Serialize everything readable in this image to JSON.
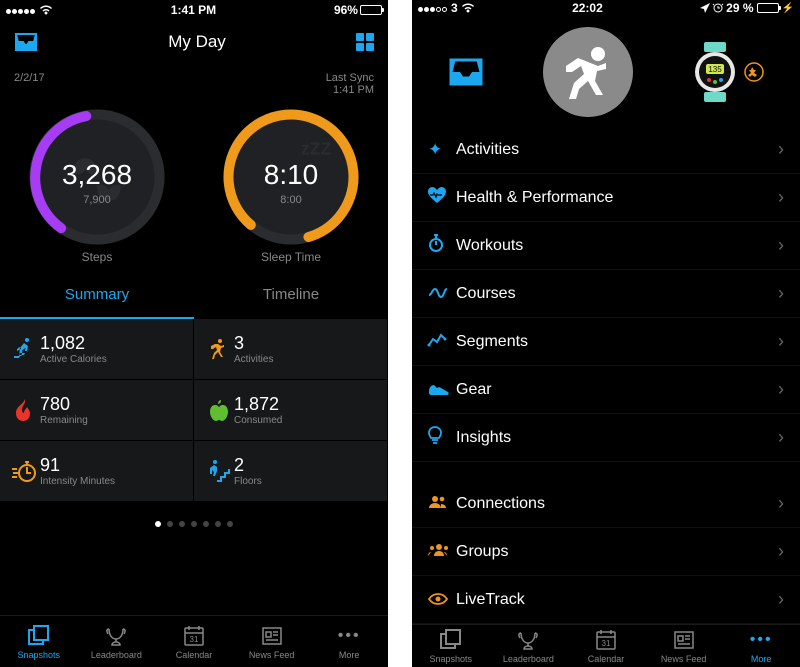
{
  "left": {
    "status": {
      "time": "1:41 PM",
      "battery_pct": "96%"
    },
    "nav": {
      "title": "My Day"
    },
    "meta": {
      "date": "2/2/17",
      "last_sync_label": "Last Sync",
      "last_sync_time": "1:41 PM"
    },
    "dials": {
      "steps": {
        "value": "3,268",
        "goal": "7,900",
        "label": "Steps"
      },
      "sleep": {
        "value": "8:10",
        "goal": "8:00",
        "label": "Sleep Time"
      }
    },
    "tabs": {
      "summary": "Summary",
      "timeline": "Timeline"
    },
    "grid": [
      {
        "value": "1,082",
        "label": "Active Calories",
        "icon": "run"
      },
      {
        "value": "3",
        "label": "Activities",
        "icon": "run2"
      },
      {
        "value": "780",
        "label": "Remaining",
        "icon": "flame"
      },
      {
        "value": "1,872",
        "label": "Consumed",
        "icon": "apple"
      },
      {
        "value": "91",
        "label": "Intensity Minutes",
        "icon": "stopwatch"
      },
      {
        "value": "2",
        "label": "Floors",
        "icon": "stairs"
      }
    ],
    "tabbar": {
      "snapshots": "Snapshots",
      "leaderboard": "Leaderboard",
      "calendar": "Calendar",
      "newsfeed": "News Feed",
      "more": "More"
    }
  },
  "right": {
    "status": {
      "carrier": "3",
      "time": "22:02",
      "battery_pct": "29 %"
    },
    "watch_value": "135",
    "menu1": [
      {
        "label": "Activities"
      },
      {
        "label": "Health & Performance"
      },
      {
        "label": "Workouts"
      },
      {
        "label": "Courses"
      },
      {
        "label": "Segments"
      },
      {
        "label": "Gear"
      },
      {
        "label": "Insights"
      }
    ],
    "menu2": [
      {
        "label": "Connections"
      },
      {
        "label": "Groups"
      },
      {
        "label": "LiveTrack"
      }
    ],
    "tabbar": {
      "snapshots": "Snapshots",
      "leaderboard": "Leaderboard",
      "calendar": "Calendar",
      "newsfeed": "News Feed",
      "more": "More"
    }
  }
}
